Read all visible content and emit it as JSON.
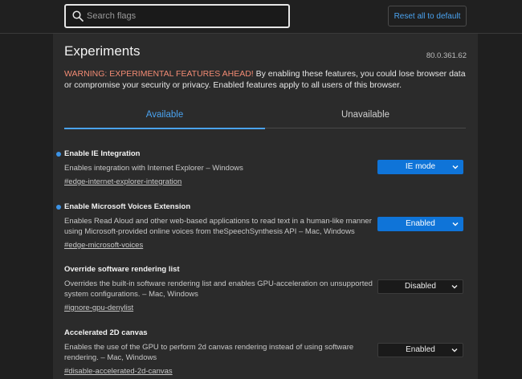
{
  "header": {
    "search_placeholder": "Search flags",
    "reset_label": "Reset all to default"
  },
  "page": {
    "title": "Experiments",
    "version": "80.0.361.62",
    "warning_prefix": "WARNING: EXPERIMENTAL FEATURES AHEAD!",
    "warning_text": " By enabling these features, you could lose browser data or compromise your security or privacy. Enabled features apply to all users of this browser."
  },
  "tabs": [
    {
      "label": "Available",
      "active": true
    },
    {
      "label": "Unavailable",
      "active": false
    }
  ],
  "flags": [
    {
      "name": "Enable IE Integration",
      "description": "Enables integration with Internet Explorer – Windows",
      "link": "#edge-internet-explorer-integration",
      "value": "IE mode",
      "modified": true
    },
    {
      "name": "Enable Microsoft Voices Extension",
      "description": "Enables Read Aloud and other web-based applications to read text in a human-like manner using Microsoft-provided online voices from theSpeechSynthesis API – Mac, Windows",
      "link": "#edge-microsoft-voices",
      "value": "Enabled",
      "modified": true
    },
    {
      "name": "Override software rendering list",
      "description": "Overrides the built-in software rendering list and enables GPU-acceleration on unsupported system configurations. – Mac, Windows",
      "link": "#ignore-gpu-denylist",
      "value": "Disabled",
      "modified": false
    },
    {
      "name": "Accelerated 2D canvas",
      "description": "Enables the use of the GPU to perform 2d canvas rendering instead of using software rendering. – Mac, Windows",
      "link": "#disable-accelerated-2d-canvas",
      "value": "Enabled",
      "modified": false
    }
  ],
  "colors": {
    "accent": "#4aa3f0",
    "warning": "#f28b74",
    "modified_dot": "#3c93e6",
    "select_blue": "#0f74d8"
  }
}
